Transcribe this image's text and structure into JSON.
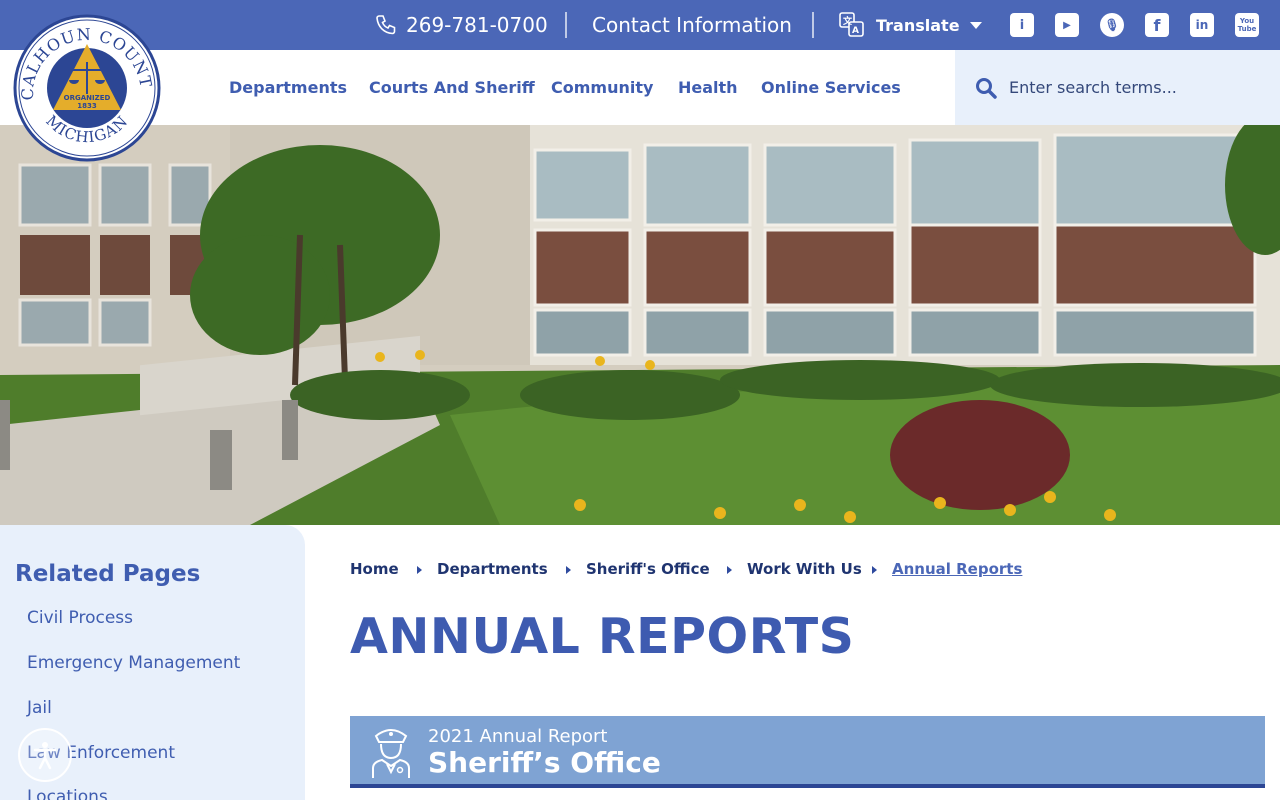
{
  "topbar": {
    "phone": "269-781-0700",
    "contact_label": "Contact Information",
    "translate_label": "Translate",
    "social": [
      {
        "icon": "info-icon",
        "glyph": "i"
      },
      {
        "icon": "youtube-play-icon",
        "glyph": "▶"
      },
      {
        "icon": "podcast-icon",
        "glyph": "🎙"
      },
      {
        "icon": "facebook-icon",
        "glyph": "f"
      },
      {
        "icon": "linkedin-icon",
        "glyph": "in"
      },
      {
        "icon": "youtube-icon",
        "glyph": "You Tube"
      }
    ]
  },
  "logo": {
    "top_text": "CALHOUN COUNTY",
    "bottom_text": "MICHIGAN",
    "organized": "ORGANIZED",
    "year": "1833"
  },
  "nav": {
    "items": [
      "Departments",
      "Courts And Sheriff",
      "Community",
      "Health",
      "Online Services"
    ]
  },
  "search": {
    "placeholder": "Enter search terms..."
  },
  "sidebar": {
    "title": "Related Pages",
    "links": [
      "Civil Process",
      "Emergency Management",
      "Jail",
      "Law Enforcement",
      "Locations"
    ]
  },
  "breadcrumb": {
    "items": [
      "Home",
      "Departments",
      "Sheriff's Office",
      "Work With Us",
      "Annual Reports"
    ]
  },
  "page": {
    "title": "ANNUAL REPORTS"
  },
  "report": {
    "subtitle": "2021 Annual Report",
    "title": "Sheriff’s Office"
  },
  "colors": {
    "topbar": "#4b67b7",
    "accent": "#3e5bb0",
    "sidebar_bg": "#e8f0fb",
    "card_bg": "#7fa3d3",
    "card_border": "#2c4694"
  }
}
